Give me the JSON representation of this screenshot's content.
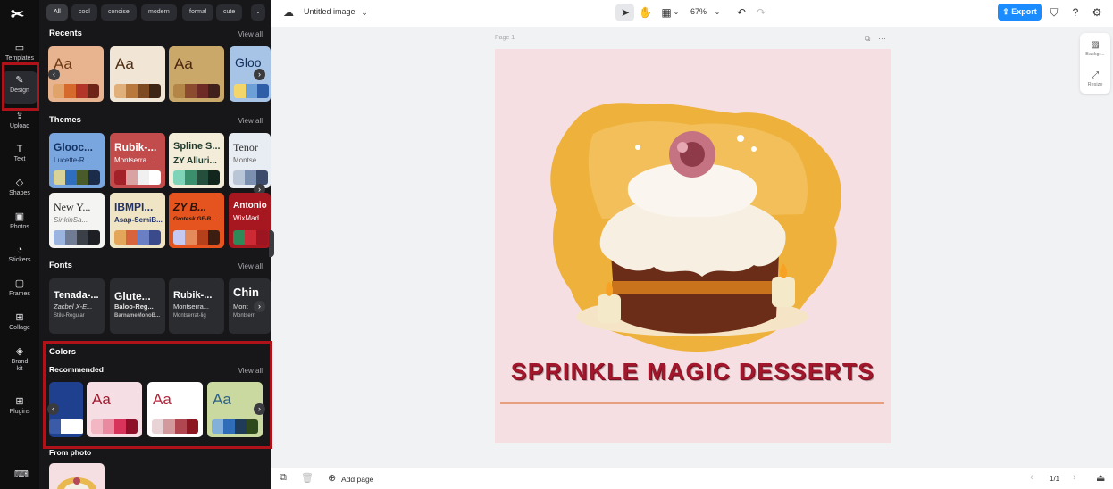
{
  "rail": {
    "items": [
      {
        "label": "Templates",
        "icon": "templates-icon"
      },
      {
        "label": "Design",
        "icon": "design-icon"
      },
      {
        "label": "Upload",
        "icon": "upload-icon"
      },
      {
        "label": "Text",
        "icon": "text-icon"
      },
      {
        "label": "Shapes",
        "icon": "shapes-icon"
      },
      {
        "label": "Photos",
        "icon": "photos-icon"
      },
      {
        "label": "Stickers",
        "icon": "stickers-icon"
      },
      {
        "label": "Frames",
        "icon": "frames-icon"
      },
      {
        "label": "Collage",
        "icon": "collage-icon"
      },
      {
        "label": "Brand kit",
        "icon": "brand-kit-icon"
      },
      {
        "label": "Plugins",
        "icon": "plugins-icon"
      }
    ],
    "active": "Design"
  },
  "panel": {
    "chips": [
      "All",
      "cool",
      "concise",
      "modern",
      "formal",
      "cute"
    ],
    "view_all": "View all",
    "recents": {
      "title": "Recents",
      "cards": [
        {
          "aa": "Aa",
          "bg": "#e8b48f",
          "swatches": [
            "#e0a46a",
            "#d66a2c",
            "#b3352a",
            "#6e2417"
          ]
        },
        {
          "aa": "Aa",
          "bg": "#f1e6d6",
          "swatches": [
            "#e1b07a",
            "#b9783c",
            "#7d4a21",
            "#3d2615"
          ]
        },
        {
          "aa": "Aa",
          "bg": "#c9a86a",
          "swatches": [
            "#b38647",
            "#8c4a2e",
            "#6e2b26",
            "#40211b"
          ]
        },
        {
          "aa": "Gloo",
          "bg": "#a7c3e6",
          "swatches": [
            "#f2d66a",
            "#6ea0d8",
            "#2f5ea8",
            "#1b3a6b"
          ]
        }
      ]
    },
    "themes": {
      "title": "Themes",
      "row1": [
        {
          "t1": "Glooc...",
          "t2": "Lucette-R...",
          "bg": "#7aa6e0",
          "fg": "#13305e",
          "swatches": [
            "#d9d39a",
            "#2f6dbd",
            "#4a5b2a",
            "#1b2c4a"
          ]
        },
        {
          "t1": "Rubik-...",
          "t2": "Montserra...",
          "bg": "#c24b4b",
          "fg": "#ffffff",
          "swatches": [
            "#a3222a",
            "#d9a3a3",
            "#f0f0f0",
            "#ffffff"
          ]
        },
        {
          "t1": "Spline S...",
          "t2": "ZY Alluri...",
          "bg": "#f3ecd8",
          "fg": "#1d3b2f",
          "swatches": [
            "#7ed3b8",
            "#3a8f6d",
            "#234f3c",
            "#12261e"
          ]
        },
        {
          "t1": "Tenor",
          "t2": "Montse",
          "bg": "#e8edf3",
          "fg": "#333333",
          "swatches": [
            "#b9c6d8",
            "#7b8fb0",
            "#3c4b6b",
            "#222c40"
          ]
        }
      ],
      "row2": [
        {
          "t1": "New Y...",
          "t2": "SinkinSa...",
          "bg": "#f4f4f2",
          "fg": "#222222",
          "swatches": [
            "#9cb4e0",
            "#6f7c94",
            "#3b3f48",
            "#1d1f24"
          ]
        },
        {
          "t1": "IBMPl...",
          "t2": "Asap-SemiB...",
          "bg": "#efe4c3",
          "fg": "#223266",
          "swatches": [
            "#e3a65a",
            "#d8643e",
            "#6b7fc4",
            "#3a4a8a"
          ]
        },
        {
          "t1": "ZY B...",
          "t2": "Grotesk GF-B...",
          "bg": "#e5531e",
          "fg": "#2a1206",
          "swatches": [
            "#c6c9f2",
            "#e58a5a",
            "#b5411b",
            "#3b1d12"
          ]
        },
        {
          "t1": "Antonio",
          "t2": "WixMad",
          "bg": "#a6171f",
          "fg": "#ffffff",
          "swatches": [
            "#2f8a5a",
            "#cc2b36",
            "#9c1520",
            "#5e0c12"
          ]
        }
      ]
    },
    "fonts": {
      "title": "Fonts",
      "cards": [
        {
          "t1": "Tenada-...",
          "t2": "Zacbel X-E...",
          "t3": "Stilu-Regular"
        },
        {
          "t1": "Glute...",
          "t2": "Baloo-Reg...",
          "t3": "BarnameMonoB..."
        },
        {
          "t1": "Rubik-...",
          "t2": "Montserra...",
          "t3": "Montserrat-lig"
        },
        {
          "t1": "Chin",
          "t2": "Mont",
          "t3": "Montserr"
        }
      ]
    },
    "colors": {
      "title": "Colors",
      "subtitle": "Recommended",
      "cards": [
        {
          "aa": "",
          "bg": "#1f3f8f",
          "fg": "#ffffff",
          "swatches": [
            "#ffffff",
            "#ffffff"
          ]
        },
        {
          "aa": "Aa",
          "bg": "#f6dfe4",
          "fg": "#a3172c",
          "swatches": [
            "#f3b7c4",
            "#e98aa0",
            "#d8335a",
            "#8e0f28"
          ]
        },
        {
          "aa": "Aa",
          "bg": "#ffffff",
          "fg": "#b3263a",
          "swatches": [
            "#e8d4d6",
            "#d39a9e",
            "#b04650",
            "#8c1622"
          ]
        },
        {
          "aa": "Aa",
          "bg": "#c9d9a0",
          "fg": "#2f6082",
          "swatches": [
            "#82b0d9",
            "#2f6db8",
            "#1f3b57",
            "#2e4a1c"
          ]
        }
      ]
    },
    "from_photo": {
      "title": "From photo"
    }
  },
  "topbar": {
    "file_name": "Untitled image",
    "zoom": "67%",
    "export_label": "Export"
  },
  "canvas": {
    "page_label": "Page 1",
    "headline": "SPRINKLE MAGIC DESSERTS"
  },
  "right_tools": [
    {
      "label": "Backgr...",
      "icon": "background-icon"
    },
    {
      "label": "Resize",
      "icon": "resize-icon"
    }
  ],
  "bottombar": {
    "add_page": "Add page",
    "pager": "1/1"
  }
}
